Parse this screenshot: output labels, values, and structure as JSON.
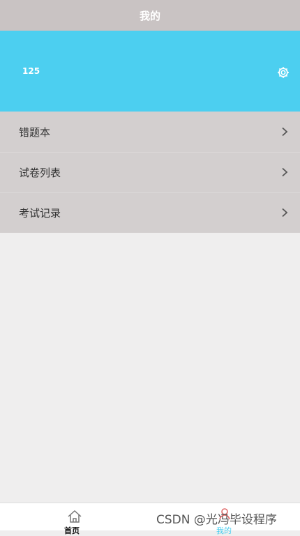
{
  "header": {
    "title": "我的"
  },
  "profile": {
    "user_id": "125",
    "settings_icon": "gear-icon"
  },
  "menu": {
    "items": [
      {
        "label": "错题本",
        "icon": "chevron-right-icon"
      },
      {
        "label": "试卷列表",
        "icon": "chevron-right-icon"
      },
      {
        "label": "考试记录",
        "icon": "chevron-right-icon"
      }
    ]
  },
  "tabbar": {
    "tabs": [
      {
        "label": "首页",
        "icon": "home-icon",
        "active": false
      },
      {
        "label": "我的",
        "icon": "user-icon",
        "active": true
      }
    ]
  },
  "watermark": {
    "text": "CSDN @光冯毕设程序"
  },
  "colors": {
    "header_bg": "#c9c3c3",
    "accent": "#4ccff0",
    "menu_bg": "#d3cfcf",
    "page_bg": "#efeeee"
  }
}
